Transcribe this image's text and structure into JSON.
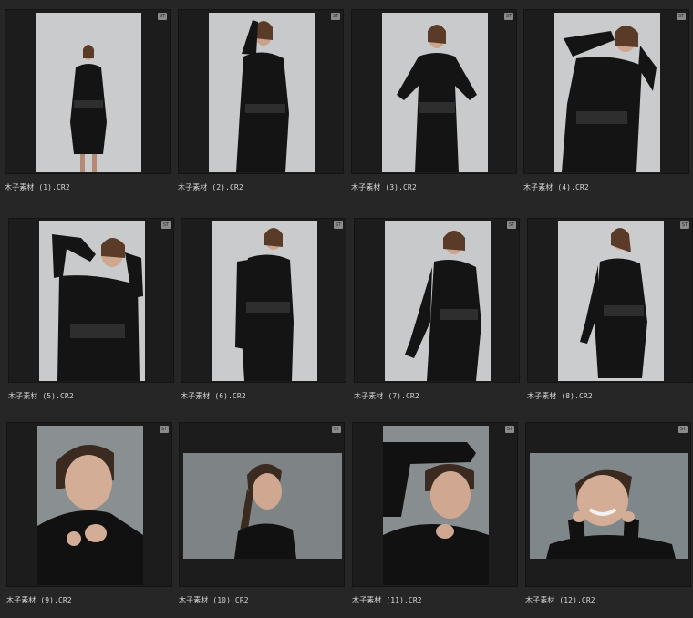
{
  "grid": {
    "items": [
      {
        "filename": "木子素材 (1).CR2",
        "badge": "ST",
        "description": "standing-pose"
      },
      {
        "filename": "木子素材 (2).CR2",
        "badge": "ST",
        "description": "hand-on-head-pose"
      },
      {
        "filename": "木子素材 (3).CR2",
        "badge": "ST",
        "description": "hands-on-hips-pose"
      },
      {
        "filename": "木子素材 (4).CR2",
        "badge": "ST",
        "description": "hands-on-head-pose"
      },
      {
        "filename": "木子素材 (5).CR2",
        "badge": "ST",
        "description": "hands-behind-head-pose"
      },
      {
        "filename": "木子素材 (6).CR2",
        "badge": "ST",
        "description": "standing-low-angle"
      },
      {
        "filename": "木子素材 (7).CR2",
        "badge": "ST",
        "description": "standing-low-angle-two"
      },
      {
        "filename": "木子素材 (8).CR2",
        "badge": "ST",
        "description": "looking-up-pose"
      },
      {
        "filename": "木子素材 (9).CR2",
        "badge": "ST",
        "description": "turtleneck-portrait"
      },
      {
        "filename": "木子素材 (10).CR2",
        "badge": "ST",
        "description": "profile-portrait"
      },
      {
        "filename": "木子素材 (11).CR2",
        "badge": "ST",
        "description": "arm-raised-portrait"
      },
      {
        "filename": "木子素材 (12).CR2",
        "badge": "ST",
        "description": "smiling-portrait"
      }
    ]
  }
}
